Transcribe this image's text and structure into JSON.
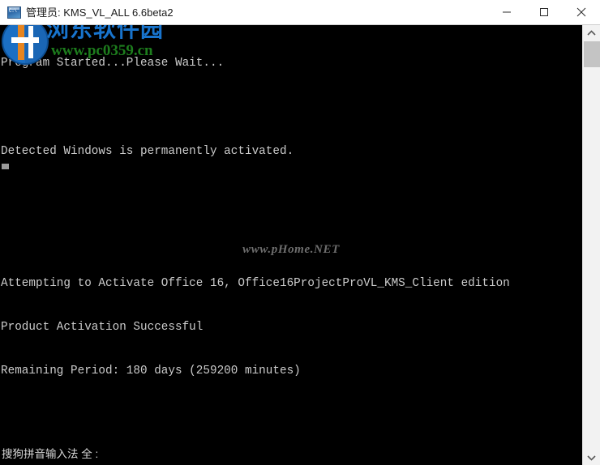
{
  "window": {
    "title": "管理员: KMS_VL_ALL 6.6beta2",
    "icon_name": "cmd-console-icon",
    "minimize_label": "−",
    "maximize_label": "□",
    "close_label": "✕"
  },
  "console": {
    "lines": [
      "Program Started...Please Wait...",
      "",
      "Detected Windows is permanently activated.",
      "",
      "",
      "Attempting to Activate Office 16, Office16ProjectProVL_KMS_Client edition",
      "Product Activation Successful",
      "Remaining Period: 180 days (259200 minutes)"
    ],
    "foreground_color": "#cccccc",
    "background_color": "#000000",
    "cursor_visible": true,
    "ime_status": "搜狗拼音输入法 全 :"
  },
  "watermarks": {
    "top_left_site_name": "浏东软件园",
    "top_left_url": "www.pc0359.cn",
    "top_left_name_color": "#1874cd",
    "top_left_url_color": "#1d7d1d",
    "center_url": "www.pHome.NET",
    "center_color": "#6e6e6e"
  },
  "scrollbar": {
    "up_arrow_name": "scroll-up-arrow",
    "down_arrow_name": "scroll-down-arrow",
    "thumb_name": "scroll-thumb"
  }
}
